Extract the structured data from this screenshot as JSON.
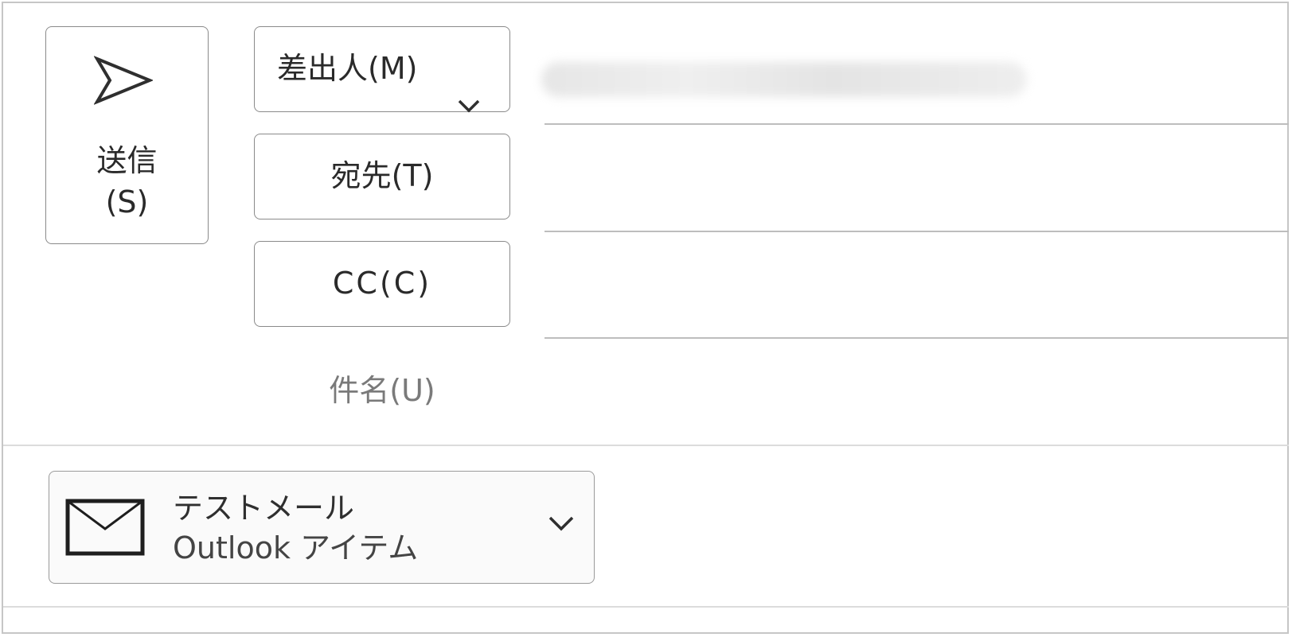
{
  "send": {
    "label_line1": "送信",
    "label_line2": "(S)",
    "icon": "send-icon"
  },
  "from": {
    "label": "差出人(M)",
    "icon": "chevron-down-icon",
    "value_obscured": true
  },
  "to": {
    "label": "宛先(T)"
  },
  "cc": {
    "label": "CC(C)"
  },
  "subject": {
    "label": "件名(U)"
  },
  "attachment": {
    "name": "テストメール",
    "type": "Outlook アイテム",
    "icon": "mail-icon",
    "menu_icon": "chevron-down-icon"
  }
}
